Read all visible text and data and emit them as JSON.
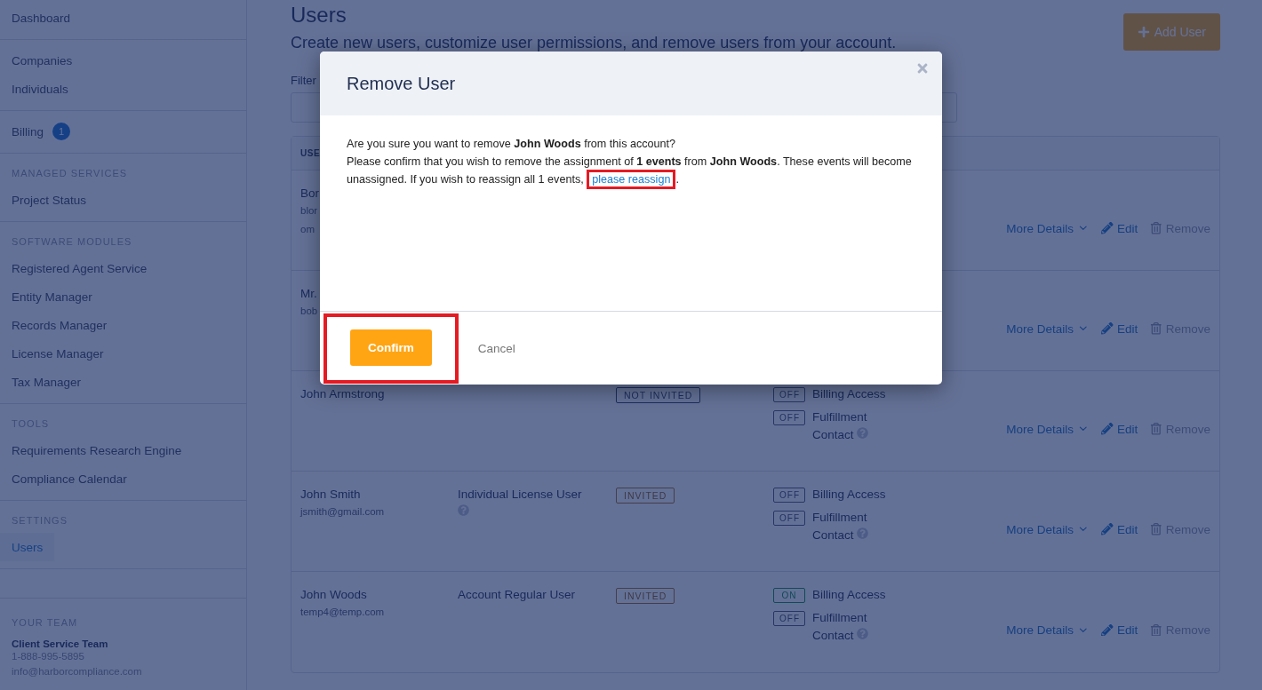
{
  "sidebar": {
    "sections": [
      {
        "items": [
          {
            "label": "Dashboard",
            "selected": false
          }
        ]
      },
      {
        "items": [
          {
            "label": "Companies",
            "selected": false
          },
          {
            "label": "Individuals",
            "selected": false
          }
        ]
      },
      {
        "items": [
          {
            "label": "Billing",
            "selected": false,
            "badge": "1"
          }
        ]
      },
      {
        "heading": "MANAGED SERVICES",
        "items": [
          {
            "label": "Project Status",
            "selected": false
          }
        ]
      },
      {
        "heading": "SOFTWARE MODULES",
        "items": [
          {
            "label": "Registered Agent Service",
            "selected": false
          },
          {
            "label": "Entity Manager",
            "selected": false
          },
          {
            "label": "Records Manager",
            "selected": false
          },
          {
            "label": "License Manager",
            "selected": false
          },
          {
            "label": "Tax Manager",
            "selected": false
          }
        ]
      },
      {
        "heading": "TOOLS",
        "items": [
          {
            "label": "Requirements Research Engine",
            "selected": false
          },
          {
            "label": "Compliance Calendar",
            "selected": false
          }
        ]
      },
      {
        "heading": "SETTINGS",
        "items": [
          {
            "label": "Users",
            "selected": true
          }
        ]
      }
    ],
    "team": {
      "heading": "YOUR TEAM",
      "name": "Client Service Team",
      "phone": "1-888-995-5895",
      "email": "info@harborcompliance.com"
    }
  },
  "page": {
    "title": "Users",
    "subtitle": "Create new users, customize user permissions, and remove users from your account.",
    "add_button": "Add User",
    "filter_label": "Filter"
  },
  "table": {
    "column_1": "USE",
    "rows": [
      {
        "name": "Bor",
        "email_lines": [
          "blor",
          "om"
        ],
        "actions": [
          "More Details",
          "Edit",
          "Remove"
        ]
      },
      {
        "name": "Mr.",
        "email_lines": [
          "bob"
        ],
        "actions": [
          "More Details",
          "Edit",
          "Remove"
        ]
      },
      {
        "name": "John Armstrong",
        "status": {
          "label": "NOT INVITED",
          "kind": "not_invited"
        },
        "toggles": [
          {
            "label": "OFF",
            "on": false,
            "text": "Billing Access"
          },
          {
            "label": "OFF",
            "on": false,
            "text": "Fulfillment Contact",
            "help": true
          }
        ],
        "actions": [
          "More Details",
          "Edit",
          "Remove"
        ]
      },
      {
        "name": "John Smith",
        "email_lines": [
          "jsmith@gmail.com"
        ],
        "role": "Individual License User",
        "role_help": true,
        "status": {
          "label": "INVITED",
          "kind": "invited"
        },
        "toggles": [
          {
            "label": "OFF",
            "on": false,
            "text": "Billing Access"
          },
          {
            "label": "OFF",
            "on": false,
            "text": "Fulfillment Contact",
            "help": true
          }
        ],
        "actions": [
          "More Details",
          "Edit",
          "Remove"
        ]
      },
      {
        "name": "John Woods",
        "email_lines": [
          "temp4@temp.com"
        ],
        "role": "Account Regular User",
        "status": {
          "label": "INVITED",
          "kind": "invited"
        },
        "toggles": [
          {
            "label": "ON",
            "on": true,
            "text": "Billing Access"
          },
          {
            "label": "OFF",
            "on": false,
            "text": "Fulfillment Contact",
            "help": true
          }
        ],
        "actions": [
          "More Details",
          "Edit",
          "Remove"
        ]
      }
    ]
  },
  "modal": {
    "title": "Remove User",
    "paragraphs": [
      "Are you sure you want to remove **John Woods** from this account?",
      "Please confirm that you wish to remove the assignment of **1 events** from **John Woods**. These events will become unassigned. If you wish to reassign all 1 events, "
    ],
    "link": {
      "label": "please reassign",
      "highlighted": true
    },
    "link_after": ".",
    "buttons": [
      {
        "label": "Confirm",
        "kind": "primary",
        "highlighted": true
      },
      {
        "label": "Cancel",
        "kind": "plain",
        "highlighted": false
      }
    ]
  }
}
